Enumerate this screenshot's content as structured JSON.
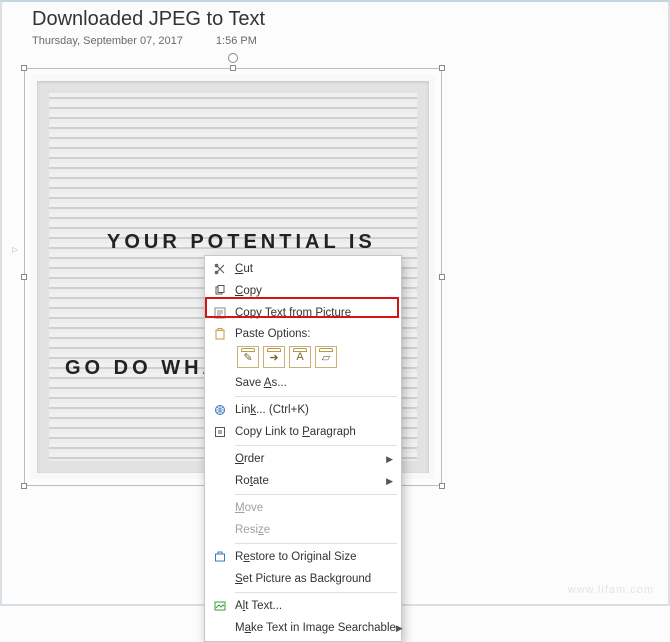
{
  "page": {
    "title": "Downloaded JPEG to Text",
    "date": "Thursday, September 07, 2017",
    "time": "1:56 PM"
  },
  "letterboard": {
    "line1": "YOUR POTENTIAL IS",
    "line2": "GO DO WHAT Y"
  },
  "context_menu": {
    "cut": "Cut",
    "copy": "Copy",
    "copy_text_from_picture": "Copy Text from Picture",
    "paste_options": "Paste Options:",
    "save_as": "Save As...",
    "link": "Link... (Ctrl+K)",
    "copy_link_paragraph": "Copy Link to Paragraph",
    "order": "Order",
    "rotate": "Rotate",
    "move": "Move",
    "resize": "Resize",
    "restore_original": "Restore to Original Size",
    "set_background": "Set Picture as Background",
    "alt_text": "Alt Text...",
    "make_searchable": "Make Text in Image Searchable"
  },
  "watermark": "www.lifam.com"
}
